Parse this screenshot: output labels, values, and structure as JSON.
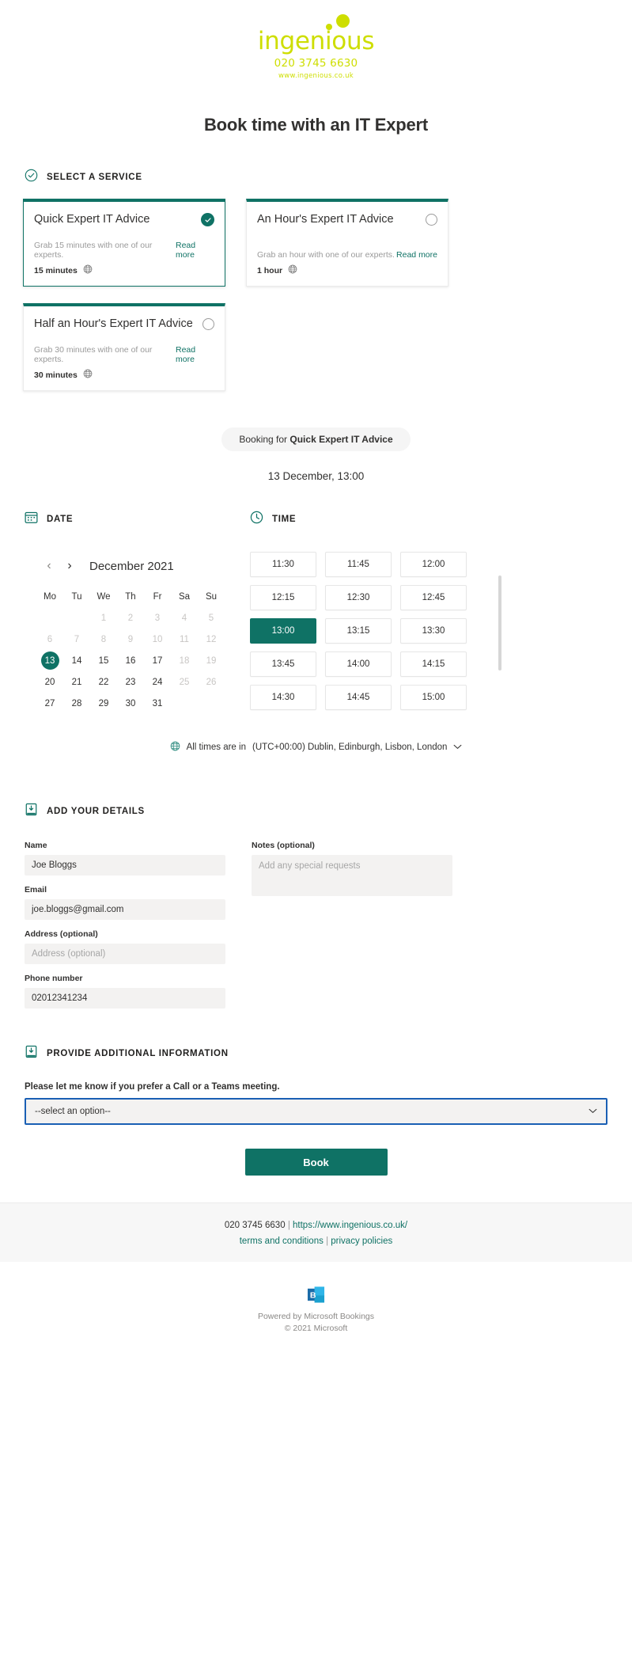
{
  "brand": {
    "logo_word": "ingenious",
    "logo_phone": "020 3745 6630",
    "logo_url": "www.ingenious.co.uk",
    "accent_green": "#cede00",
    "accent_teal": "#0f7265"
  },
  "page_title": "Book time with an IT Expert",
  "select_service": {
    "header": "SELECT A SERVICE",
    "cards": [
      {
        "title": "Quick Expert IT Advice",
        "description": "Grab 15 minutes with one of our experts.",
        "read_more": "Read more",
        "duration": "15 minutes",
        "selected": true
      },
      {
        "title": "An Hour's Expert IT Advice",
        "description": "Grab an hour with one of our experts.",
        "read_more": "Read more",
        "duration": "1 hour",
        "selected": false
      },
      {
        "title": "Half an Hour's Expert IT Advice",
        "description": "Grab 30 minutes with one of our experts.",
        "read_more": "Read more",
        "duration": "30 minutes",
        "selected": false
      }
    ]
  },
  "booking_summary": {
    "prefix": "Booking for ",
    "service": "Quick Expert IT Advice",
    "chosen_datetime": "13 December, 13:00"
  },
  "date": {
    "header": "DATE",
    "prev_label": "‹",
    "next_label": "›",
    "month_label": "December 2021",
    "day_names": [
      "Mo",
      "Tu",
      "We",
      "Th",
      "Fr",
      "Sa",
      "Su"
    ],
    "weeks": [
      [
        {
          "label": "",
          "state": "empty"
        },
        {
          "label": "",
          "state": "empty"
        },
        {
          "label": "1",
          "state": "muted"
        },
        {
          "label": "2",
          "state": "muted"
        },
        {
          "label": "3",
          "state": "muted"
        },
        {
          "label": "4",
          "state": "muted"
        },
        {
          "label": "5",
          "state": "muted"
        }
      ],
      [
        {
          "label": "6",
          "state": "muted"
        },
        {
          "label": "7",
          "state": "muted"
        },
        {
          "label": "8",
          "state": "muted"
        },
        {
          "label": "9",
          "state": "muted"
        },
        {
          "label": "10",
          "state": "muted"
        },
        {
          "label": "11",
          "state": "muted"
        },
        {
          "label": "12",
          "state": "muted"
        }
      ],
      [
        {
          "label": "13",
          "state": "selected"
        },
        {
          "label": "14",
          "state": "available"
        },
        {
          "label": "15",
          "state": "available"
        },
        {
          "label": "16",
          "state": "available"
        },
        {
          "label": "17",
          "state": "available"
        },
        {
          "label": "18",
          "state": "muted"
        },
        {
          "label": "19",
          "state": "muted"
        }
      ],
      [
        {
          "label": "20",
          "state": "available"
        },
        {
          "label": "21",
          "state": "available"
        },
        {
          "label": "22",
          "state": "available"
        },
        {
          "label": "23",
          "state": "available"
        },
        {
          "label": "24",
          "state": "available"
        },
        {
          "label": "25",
          "state": "muted"
        },
        {
          "label": "26",
          "state": "muted"
        }
      ],
      [
        {
          "label": "27",
          "state": "available"
        },
        {
          "label": "28",
          "state": "available"
        },
        {
          "label": "29",
          "state": "available"
        },
        {
          "label": "30",
          "state": "available"
        },
        {
          "label": "31",
          "state": "available"
        },
        {
          "label": "",
          "state": "empty"
        },
        {
          "label": "",
          "state": "empty"
        }
      ]
    ]
  },
  "time": {
    "header": "TIME",
    "slots": [
      {
        "label": "11:30",
        "selected": false
      },
      {
        "label": "11:45",
        "selected": false
      },
      {
        "label": "12:00",
        "selected": false
      },
      {
        "label": "12:15",
        "selected": false
      },
      {
        "label": "12:30",
        "selected": false
      },
      {
        "label": "12:45",
        "selected": false
      },
      {
        "label": "13:00",
        "selected": true
      },
      {
        "label": "13:15",
        "selected": false
      },
      {
        "label": "13:30",
        "selected": false
      },
      {
        "label": "13:45",
        "selected": false
      },
      {
        "label": "14:00",
        "selected": false
      },
      {
        "label": "14:15",
        "selected": false
      },
      {
        "label": "14:30",
        "selected": false
      },
      {
        "label": "14:45",
        "selected": false
      },
      {
        "label": "15:00",
        "selected": false
      }
    ],
    "timezone_prefix": "All times are in ",
    "timezone_value": "(UTC+00:00) Dublin, Edinburgh, Lisbon, London",
    "timezone_chevron": "⌄"
  },
  "details": {
    "header": "ADD YOUR DETAILS",
    "name_label": "Name",
    "name_value": "Joe Bloggs",
    "email_label": "Email",
    "email_value": "joe.bloggs@gmail.com",
    "address_label": "Address (optional)",
    "address_placeholder": "Address (optional)",
    "phone_label": "Phone number",
    "phone_value": "02012341234",
    "notes_label": "Notes (optional)",
    "notes_placeholder": "Add any special requests"
  },
  "additional": {
    "header": "PROVIDE ADDITIONAL INFORMATION",
    "question": "Please let me know if you prefer a Call or a Teams meeting.",
    "select_value": "--select an option--",
    "select_chevron": "⌄"
  },
  "book_button": "Book",
  "footer": {
    "phone": "020 3745 6630",
    "separator": "|",
    "website": "https://www.ingenious.co.uk/",
    "terms": "terms and conditions",
    "privacy": "privacy policies",
    "powered_by": "Powered by Microsoft Bookings",
    "copyright": "© 2021 Microsoft"
  }
}
